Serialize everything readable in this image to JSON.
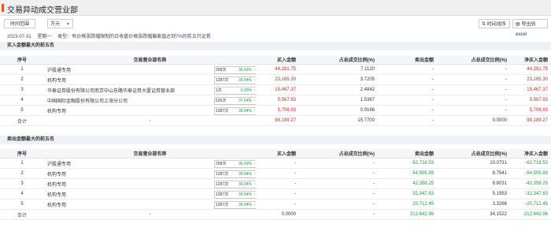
{
  "header": {
    "title": "交易异动成交营业部"
  },
  "controls": {
    "time_range_label": "时间范围",
    "unit_value": "万元",
    "sort_label": "时间排序",
    "export_label": "导出到excel"
  },
  "info": {
    "date": "2023-07-31",
    "weekday": "星期一",
    "type_text": "类型：有价格涨跌幅限制的日收盘价格涨跌幅偏离值达到7%的前五只证券"
  },
  "columns": {
    "seq": "序号",
    "name": "交易营业部名称",
    "buy": "买入金额",
    "buy_pct": "占总成交比例(%)",
    "sell": "卖出金额",
    "sell_pct": "占总成交比例(%)",
    "net": "净买入金额"
  },
  "buy_section": {
    "title": "买入金额最大的前五名",
    "rows": [
      {
        "seq": "1",
        "name": "沪股通专用",
        "count": "258次",
        "pct": "36.43%",
        "buy": "44,281.75",
        "buy_pct": "7.1120",
        "sell": "-",
        "sell_pct": "-",
        "net": "44,281.75"
      },
      {
        "seq": "2",
        "name": "机构专用",
        "count": "1287次",
        "pct": "39.94%",
        "buy": "23,165.30",
        "buy_pct": "3.7205",
        "sell": "-",
        "sell_pct": "-",
        "net": "23,165.30"
      },
      {
        "seq": "3",
        "name": "华泰证券股份有限公司南京中山东路华泰证券大厦证券营业部",
        "count": "1次",
        "pct": "0.00%",
        "buy": "15,467.37",
        "buy_pct": "2.4842",
        "sell": "-",
        "sell_pct": "-",
        "net": "15,467.37"
      },
      {
        "seq": "4",
        "name": "中国国际金融股份有限公司上海分公司",
        "count": "526次",
        "pct": "37.64%",
        "buy": "9,567.93",
        "buy_pct": "1.5367",
        "sell": "-",
        "sell_pct": "-",
        "net": "9,567.93"
      },
      {
        "seq": "5",
        "name": "机构专用",
        "count": "1287次",
        "pct": "39.94%",
        "buy": "5,706.93",
        "buy_pct": "0.9166",
        "sell": "-",
        "sell_pct": "-",
        "net": "5,706.93"
      }
    ],
    "total": {
      "label": "合计",
      "name": "-",
      "buy": "98,189.27",
      "buy_pct": "15.7700",
      "sell": "-",
      "sell_pct": "0.0000",
      "net": "98,189.27"
    }
  },
  "sell_section": {
    "title": "卖出金额最大的前五名",
    "rows": [
      {
        "seq": "1",
        "name": "沪股通专用",
        "count": "258次",
        "pct": "36.43%",
        "buy": "-",
        "buy_pct": "-",
        "sell": "62,718.53",
        "sell_pct": "10.0731",
        "net": "-62,718.53"
      },
      {
        "seq": "2",
        "name": "机构专用",
        "count": "1287次",
        "pct": "39.94%",
        "buy": "-",
        "buy_pct": "-",
        "sell": "54,505.89",
        "sell_pct": "8.7541",
        "net": "-54,505.89"
      },
      {
        "seq": "3",
        "name": "机构专用",
        "count": "1287次",
        "pct": "39.94%",
        "buy": "-",
        "buy_pct": "-",
        "sell": "42,358.25",
        "sell_pct": "6.8031",
        "net": "-42,358.25"
      },
      {
        "seq": "4",
        "name": "机构专用",
        "count": "1287次",
        "pct": "39.94%",
        "buy": "-",
        "buy_pct": "-",
        "sell": "32,347.83",
        "sell_pct": "5.1953",
        "net": "-32,347.83"
      },
      {
        "seq": "5",
        "name": "机构专用",
        "count": "1287次",
        "pct": "39.94%",
        "buy": "-",
        "buy_pct": "-",
        "sell": "20,712.45",
        "sell_pct": "3.3266",
        "net": "-20,712.45"
      }
    ],
    "total": {
      "label": "合计",
      "name": "-",
      "buy": "0.0000",
      "buy_pct": "-",
      "sell": "212,642.96",
      "sell_pct": "34.1522",
      "net": "-212,642.96"
    }
  },
  "colors": {
    "up": "#e02020",
    "down": "#1a9a3a",
    "accent": "#e8541e"
  }
}
